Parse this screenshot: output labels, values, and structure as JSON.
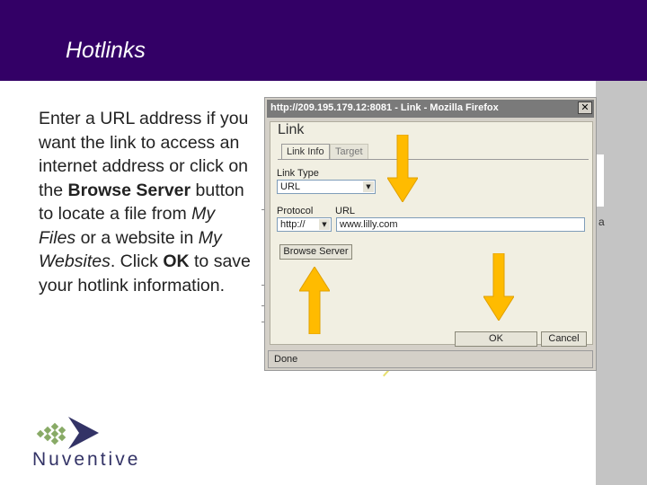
{
  "header": {
    "title": "Hotlinks"
  },
  "instructions": {
    "p1": "Enter a URL address if you want the link to access an internet address or click on the ",
    "bold1": "Browse Server",
    "p2": " button to locate a file from ",
    "italic1": "My Files",
    "p3": " or a website in ",
    "italic2": "My Websites",
    "p4": ".  Click ",
    "bold2": "OK",
    "p5": " to save your hotlink information."
  },
  "browser_window": {
    "title": "http://209.195.179.12:8081 - Link - Mozilla Firefox",
    "close_label": "✕",
    "status": "Done"
  },
  "dialog": {
    "title": "Link",
    "tabs": [
      "Link Info",
      "Target"
    ],
    "link_type_label": "Link Type",
    "link_type_value": "URL",
    "protocol_label": "Protocol",
    "protocol_value": "http://",
    "url_label": "URL",
    "url_value": "www.lilly.com",
    "browse_button": "Browse Server",
    "ok_button": "OK",
    "cancel_button": "Cancel"
  },
  "background": {
    "side_char": "a"
  },
  "colors": {
    "header": "#330066",
    "arrow": "#ffbb00",
    "logo": "#333366"
  },
  "logo": {
    "text": "Nuventive"
  }
}
